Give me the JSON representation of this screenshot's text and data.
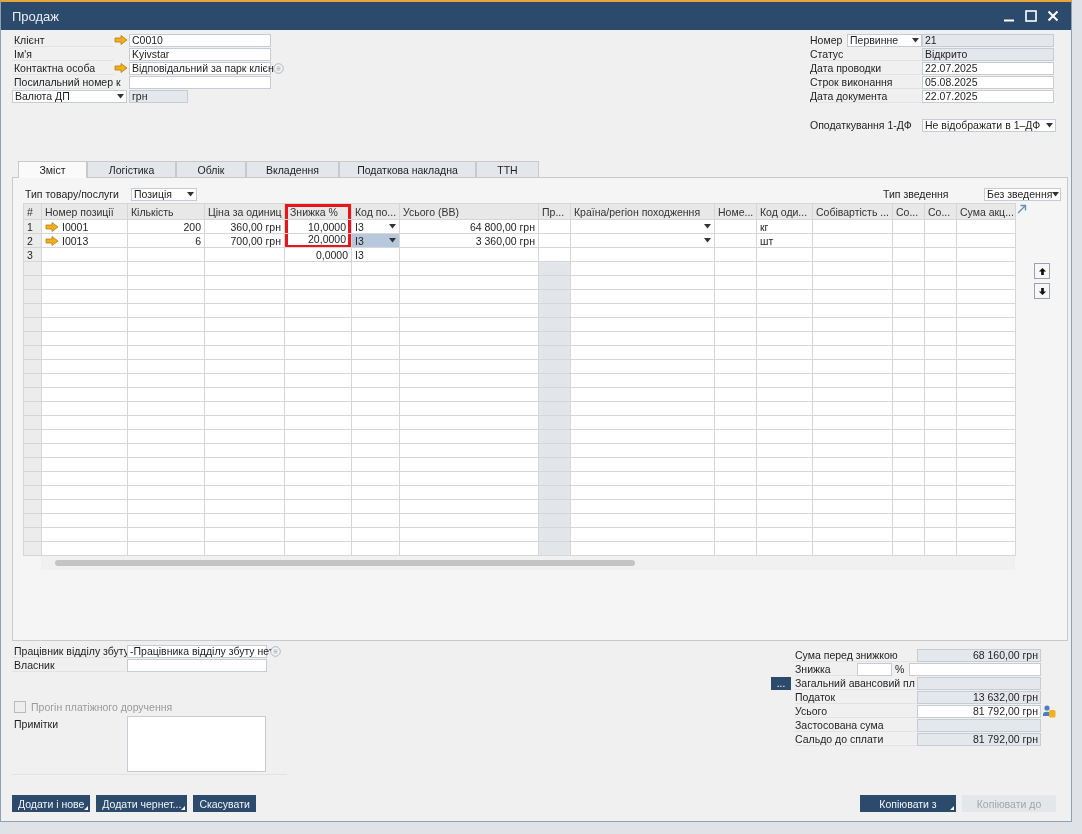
{
  "window": {
    "title": "Продаж"
  },
  "header_left": [
    {
      "kind": "text",
      "label": "Клієнт",
      "link": true,
      "info": false,
      "value": "C0010",
      "readonly": false
    },
    {
      "kind": "text",
      "label": "Ім'я",
      "link": false,
      "info": false,
      "value": "Kyivstar",
      "readonly": false
    },
    {
      "kind": "select",
      "label": "Контактна особа",
      "link": true,
      "info": true,
      "value": "Відповідальний за парк клієн",
      "readonly": false
    },
    {
      "kind": "text",
      "label": "Посилальний номер к",
      "link": false,
      "info": false,
      "readonly": false
    },
    {
      "kind": "label_select",
      "label": "Валюта ДП",
      "link": false,
      "info": false,
      "value": "грн",
      "readonly": true
    }
  ],
  "header_right": [
    {
      "kind": "series",
      "label": "Номер",
      "option": "Первинне",
      "value": "21",
      "readonly": true
    },
    {
      "kind": "text",
      "label": "Статус",
      "value": "Відкрито",
      "readonly": true
    },
    {
      "kind": "text",
      "label": "Дата проводки",
      "value": "22.07.2025",
      "readonly": false
    },
    {
      "kind": "text",
      "label": "Строк виконання",
      "value": "05.08.2025",
      "readonly": false
    },
    {
      "kind": "text",
      "label": "Дата документа",
      "value": "22.07.2025",
      "readonly": false
    }
  ],
  "tax_1df": {
    "label": "Оподаткування 1-ДФ",
    "value": "Не відображати в 1–ДФ"
  },
  "tabs": [
    {
      "label": "Зміст",
      "selected": true
    },
    {
      "label": "Логістика",
      "selected": false
    },
    {
      "label": "Облік",
      "selected": false
    },
    {
      "label": "Вкладення",
      "selected": false
    },
    {
      "label": "Податкова накладна",
      "selected": false
    },
    {
      "label": "ТТН",
      "selected": false
    }
  ],
  "item_type": {
    "label": "Тип товару/послуги",
    "value": "Позиція"
  },
  "summary_type": {
    "label": "Тип зведення",
    "value": "Без зведення"
  },
  "table": {
    "columns": [
      {
        "label": "#",
        "kind": "index",
        "highlighted": false
      },
      {
        "label": "Номер позиції",
        "kind": "text",
        "highlighted": false
      },
      {
        "label": "Кількість",
        "kind": "number",
        "highlighted": false
      },
      {
        "label": "Ціна за одиниц",
        "kind": "number",
        "highlighted": false
      },
      {
        "label": "Знижка %",
        "kind": "number",
        "highlighted": true
      },
      {
        "label": "Код по...",
        "kind": "select",
        "highlighted": false
      },
      {
        "label": "Усього (ВВ)",
        "kind": "number",
        "highlighted": false
      },
      {
        "label": "Пр...",
        "kind": "shaded",
        "highlighted": false
      },
      {
        "label": "Країна/регіон походження",
        "kind": "select",
        "highlighted": false
      },
      {
        "label": "Номе...",
        "kind": "text",
        "highlighted": false
      },
      {
        "label": "Код оди...",
        "kind": "text",
        "highlighted": false
      },
      {
        "label": "Собівартість ...",
        "kind": "text",
        "highlighted": false
      },
      {
        "label": "Со...",
        "kind": "text",
        "highlighted": false
      },
      {
        "label": "Со...",
        "kind": "text",
        "highlighted": false
      },
      {
        "label": "Сума акц...",
        "kind": "text",
        "highlighted": false
      }
    ],
    "rows": [
      {
        "link": true,
        "dropdowns": true,
        "highlighted": true,
        "cells": [
          {
            "text": "1",
            "selected": false
          },
          {
            "text": "I0001",
            "selected": false
          },
          {
            "text": "200",
            "selected": false
          },
          {
            "text": "360,00 грн",
            "selected": false
          },
          {
            "text": "10,0000",
            "selected": false
          },
          {
            "text": "I3",
            "selected": false
          },
          {
            "text": "64 800,00 грн",
            "selected": false
          },
          {
            "selected": false
          },
          {
            "selected": false
          },
          {
            "selected": false
          },
          {
            "text": "кг",
            "selected": false
          },
          {
            "selected": false
          },
          {
            "selected": false
          },
          {
            "selected": false
          },
          {
            "selected": false
          }
        ]
      },
      {
        "link": true,
        "dropdowns": true,
        "highlighted": true,
        "cells": [
          {
            "text": "2",
            "selected": false
          },
          {
            "text": "I0013",
            "selected": false
          },
          {
            "text": "6",
            "selected": false
          },
          {
            "text": "700,00 грн",
            "selected": false
          },
          {
            "text": "20,0000",
            "selected": false
          },
          {
            "text": "I3",
            "selected": true
          },
          {
            "text": "3 360,00 грн",
            "selected": false
          },
          {
            "selected": false
          },
          {
            "selected": false
          },
          {
            "selected": false
          },
          {
            "text": "шт",
            "selected": false
          },
          {
            "selected": false
          },
          {
            "selected": false
          },
          {
            "selected": false
          },
          {
            "selected": false
          }
        ]
      },
      {
        "link": false,
        "dropdowns": false,
        "highlighted": false,
        "cells": [
          {
            "text": "3",
            "selected": false
          },
          {
            "selected": false
          },
          {
            "selected": false
          },
          {
            "selected": false
          },
          {
            "text": "0,0000",
            "selected": false
          },
          {
            "text": "I3",
            "selected": false
          },
          {
            "selected": false
          },
          {
            "selected": false
          },
          {
            "selected": false
          },
          {
            "selected": false
          },
          {
            "selected": false
          },
          {
            "selected": false
          },
          {
            "selected": false
          },
          {
            "selected": false
          },
          {
            "selected": false
          }
        ]
      }
    ]
  },
  "sales_employee": {
    "label": "Працівник відділу збуту",
    "value": "-Працівника відділу збуту не"
  },
  "owner": {
    "label": "Власник"
  },
  "payment_run": {
    "label": "Прогін платіжного доручення",
    "checked": false,
    "disabled": true
  },
  "remarks": {
    "label": "Примітки"
  },
  "totals": [
    {
      "kind": "amount",
      "label": "Сума перед знижкою",
      "value": "68 160,00 грн",
      "readonly": true
    },
    {
      "kind": "percent",
      "label": "Знижка",
      "unit": "%",
      "readonly": false
    },
    {
      "kind": "advance",
      "label": "Загальний авансовий пл",
      "button": "...",
      "readonly": true
    },
    {
      "kind": "amount",
      "label": "Податок",
      "value": "13 632,00 грн",
      "readonly": true
    },
    {
      "kind": "total",
      "label": "Усього",
      "value": "81 792,00 грн",
      "readonly": false
    },
    {
      "kind": "amount",
      "label": "Застосована сума",
      "readonly": true
    },
    {
      "kind": "amount",
      "label": "Сальдо до сплати",
      "value": "81 792,00 грн",
      "readonly": true
    }
  ],
  "buttons_left": [
    {
      "label": "Додати і нове",
      "menu": true,
      "disabled": false
    },
    {
      "label": "Додати чернет...",
      "menu": true,
      "disabled": false
    },
    {
      "label": "Скасувати",
      "menu": false,
      "disabled": false
    }
  ],
  "buttons_right": [
    {
      "label": "Копіювати з",
      "menu": true,
      "disabled": false
    },
    {
      "label": "Копіювати до",
      "menu": false,
      "disabled": true
    }
  ]
}
